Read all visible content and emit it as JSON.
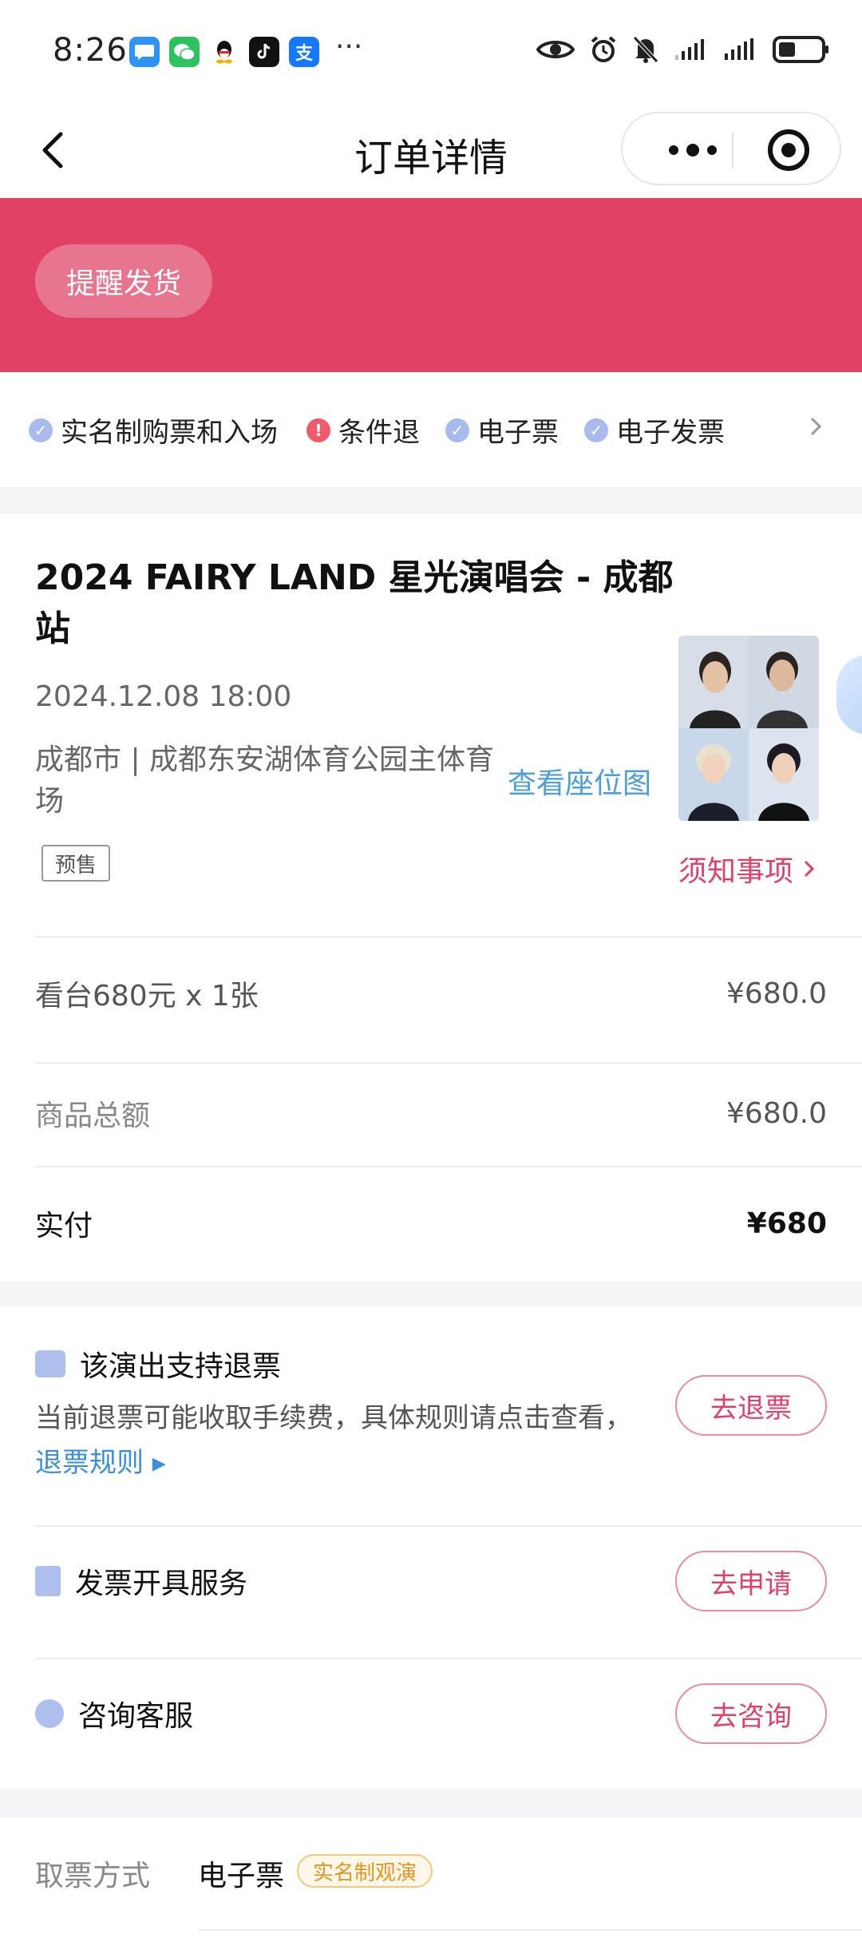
{
  "status_bar": {
    "time": "8:26",
    "dots": "···",
    "app_icons": [
      {
        "name": "messages-icon",
        "color": "#2f93f5",
        "glyph": "●"
      },
      {
        "name": "wechat-icon",
        "color": "#2ec160",
        "glyph": "◉"
      },
      {
        "name": "qq-icon",
        "color": "#ffffff",
        "glyph": "🐧"
      },
      {
        "name": "tiktok-icon",
        "color": "#111111",
        "glyph": "♪"
      },
      {
        "name": "alipay-icon",
        "color": "#1677ff",
        "glyph": "支"
      }
    ]
  },
  "nav": {
    "title": "订单详情"
  },
  "header": {
    "remind_label": "提醒发货",
    "color": "#e04164"
  },
  "tags": [
    {
      "label": "实名制购票和入场",
      "type": "check"
    },
    {
      "label": "条件退",
      "type": "warn"
    },
    {
      "label": "电子票",
      "type": "check"
    },
    {
      "label": "电子发票",
      "type": "check"
    }
  ],
  "event": {
    "title": "2024 FAIRY LAND 星光演唱会 - 成都站",
    "datetime": "2024.12.08 18:00",
    "venue": "成都市 | 成都东安湖体育公园主体育场",
    "seat_map_link": "查看座位图",
    "presale_badge": "预售",
    "notice_link": "须知事项"
  },
  "order": {
    "item_label": "看台680元 x 1张",
    "item_price": "¥680.0",
    "total_label": "商品总额",
    "total_value": "¥680.0",
    "paid_label": "实付",
    "paid_value": "¥680"
  },
  "services": {
    "refund": {
      "title": "该演出支持退票",
      "desc": "当前退票可能收取手续费，具体规则请点击查看，",
      "rule_link": "退票规则",
      "button": "去退票"
    },
    "invoice": {
      "title": "发票开具服务",
      "button": "去申请"
    },
    "support": {
      "title": "咨询客服",
      "button": "去咨询"
    }
  },
  "ticket_method": {
    "label": "取票方式",
    "value": "电子票",
    "badge": "实名制观演"
  },
  "accent_colors": {
    "brand_red": "#e04164",
    "link_blue": "#4a9fd8",
    "pill_pink": "#e0406a"
  }
}
